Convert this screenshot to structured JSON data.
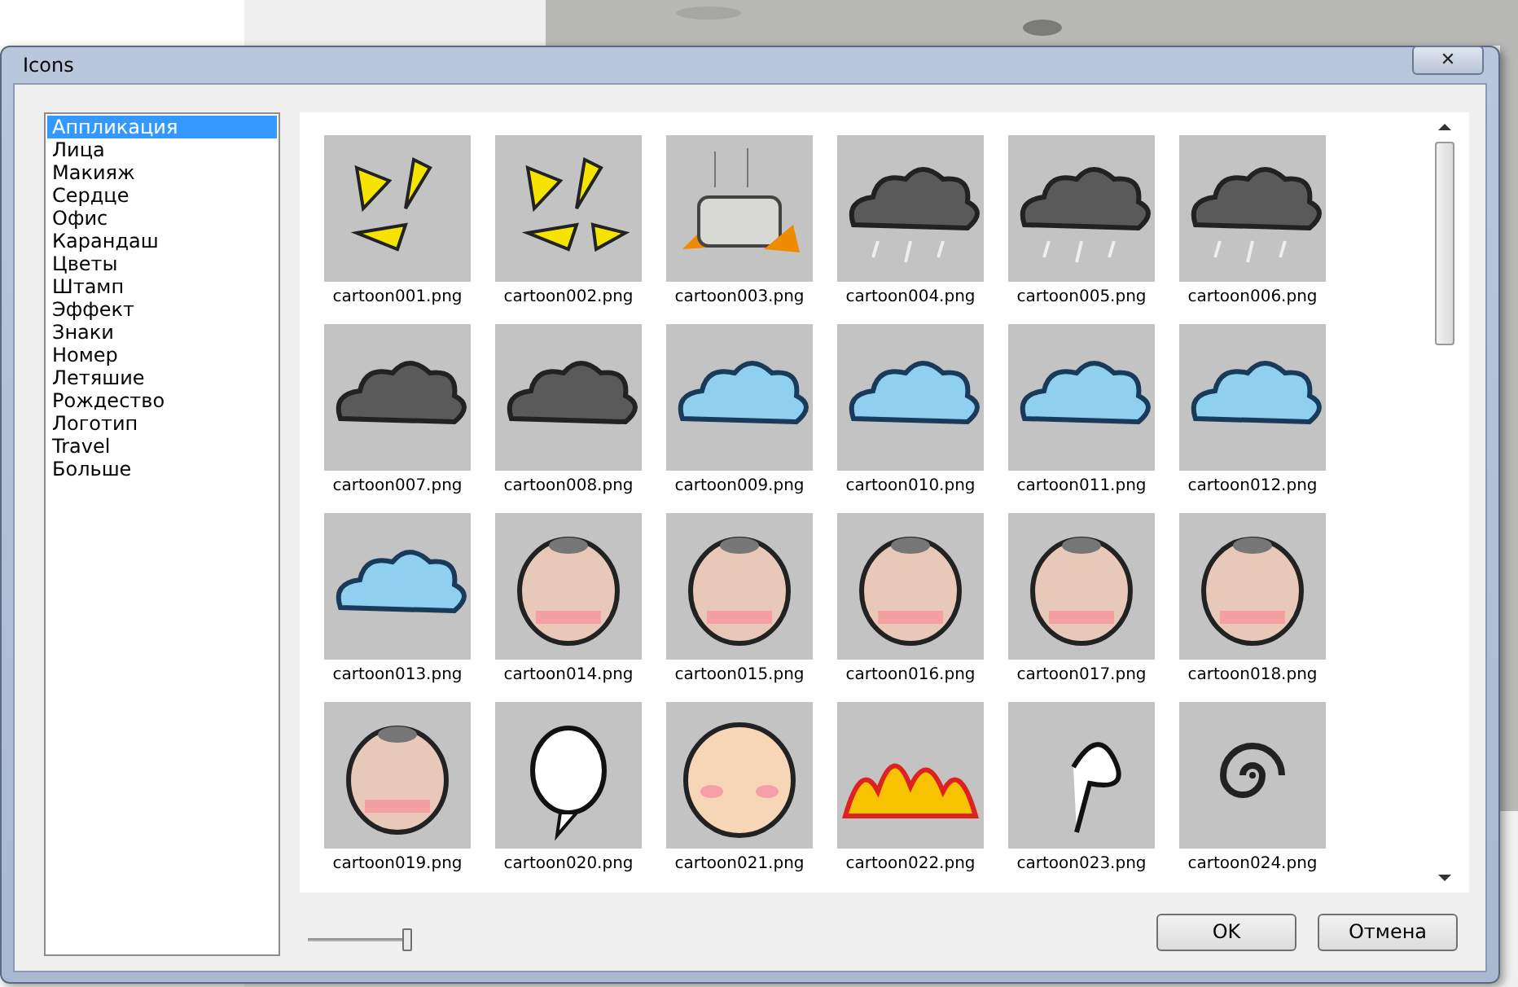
{
  "window": {
    "title": "Icons",
    "close": "✕"
  },
  "categories": [
    {
      "label": "Аппликация",
      "selected": true
    },
    {
      "label": "Лица",
      "selected": false
    },
    {
      "label": "Макияж",
      "selected": false
    },
    {
      "label": "Сердце",
      "selected": false
    },
    {
      "label": "Офис",
      "selected": false
    },
    {
      "label": "Карандаш",
      "selected": false
    },
    {
      "label": "Цветы",
      "selected": false
    },
    {
      "label": "Штамп",
      "selected": false
    },
    {
      "label": "Эффект",
      "selected": false
    },
    {
      "label": "Знаки",
      "selected": false
    },
    {
      "label": "Номер",
      "selected": false
    },
    {
      "label": "Летяшие",
      "selected": false
    },
    {
      "label": "Рождество",
      "selected": false
    },
    {
      "label": "Логотип",
      "selected": false
    },
    {
      "label": "Travel",
      "selected": false
    },
    {
      "label": "Больше",
      "selected": false
    }
  ],
  "icons": [
    {
      "label": "cartoon001.png"
    },
    {
      "label": "cartoon002.png"
    },
    {
      "label": "cartoon003.png"
    },
    {
      "label": "cartoon004.png"
    },
    {
      "label": "cartoon005.png"
    },
    {
      "label": "cartoon006.png"
    },
    {
      "label": "cartoon007.png"
    },
    {
      "label": "cartoon008.png"
    },
    {
      "label": "cartoon009.png"
    },
    {
      "label": "cartoon010.png"
    },
    {
      "label": "cartoon011.png"
    },
    {
      "label": "cartoon012.png"
    },
    {
      "label": "cartoon013.png"
    },
    {
      "label": "cartoon014.png"
    },
    {
      "label": "cartoon015.png"
    },
    {
      "label": "cartoon016.png"
    },
    {
      "label": "cartoon017.png"
    },
    {
      "label": "cartoon018.png"
    },
    {
      "label": "cartoon019.png"
    },
    {
      "label": "cartoon020.png"
    },
    {
      "label": "cartoon021.png"
    },
    {
      "label": "cartoon022.png"
    },
    {
      "label": "cartoon023.png"
    },
    {
      "label": "cartoon024.png"
    }
  ],
  "size_slider": {
    "level": 0.95
  },
  "buttons": [
    {
      "label": "OK"
    },
    {
      "label": "Отмена"
    }
  ]
}
